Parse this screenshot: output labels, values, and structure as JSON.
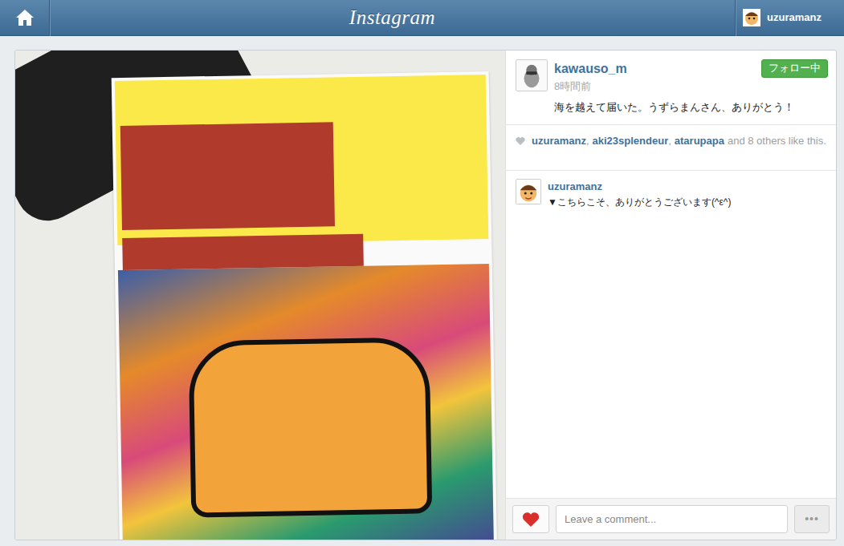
{
  "topbar": {
    "logo": "Instagram",
    "user": "uzuramanz"
  },
  "post": {
    "user": "kawauso_m",
    "time": "8時間前",
    "caption": "海を越えて届いた。うずらまんさん、ありがとう！",
    "follow": {
      "label": "フォロー中",
      "following": true
    }
  },
  "likes": {
    "names": [
      "uzuramanz",
      "aki23splendeur",
      "atarupapa"
    ],
    "separator": ",",
    "suffix": "and 8 others like this."
  },
  "comments": [
    {
      "user": "uzuramanz",
      "text": "▼こちらこそ、ありがとうございます(^ε^)"
    }
  ],
  "comment_box": {
    "placeholder": "Leave a comment...",
    "liked": true,
    "more": "•••"
  }
}
